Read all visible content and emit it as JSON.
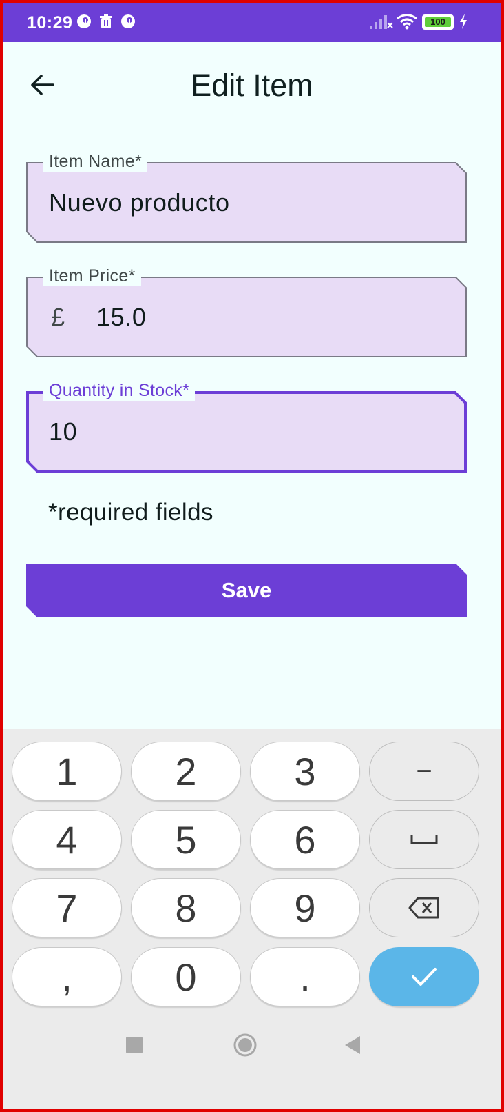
{
  "status_bar": {
    "time": "10:29",
    "battery": "100",
    "background": "#6c3ed6"
  },
  "app_bar": {
    "title": "Edit Item",
    "back_icon": "arrow-left-icon"
  },
  "form": {
    "fields": [
      {
        "label": "Item Name*",
        "value": "Nuevo producto",
        "prefix": ""
      },
      {
        "label": "Item Price*",
        "value": "15.0",
        "prefix": "£"
      },
      {
        "label": "Quantity in Stock*",
        "value": "10",
        "prefix": ""
      }
    ],
    "required_note": "*required fields",
    "save_label": "Save"
  },
  "keyboard": {
    "keys": [
      "1",
      "2",
      "3",
      "−",
      "4",
      "5",
      "6",
      "space",
      "7",
      "8",
      "9",
      "backspace",
      ",",
      "0",
      ".",
      "enter"
    ]
  },
  "colors": {
    "accent": "#6c3ed6",
    "field_fill": "#e8dcf6",
    "background": "#f2fffe",
    "enter_key": "#5bb6e8"
  }
}
